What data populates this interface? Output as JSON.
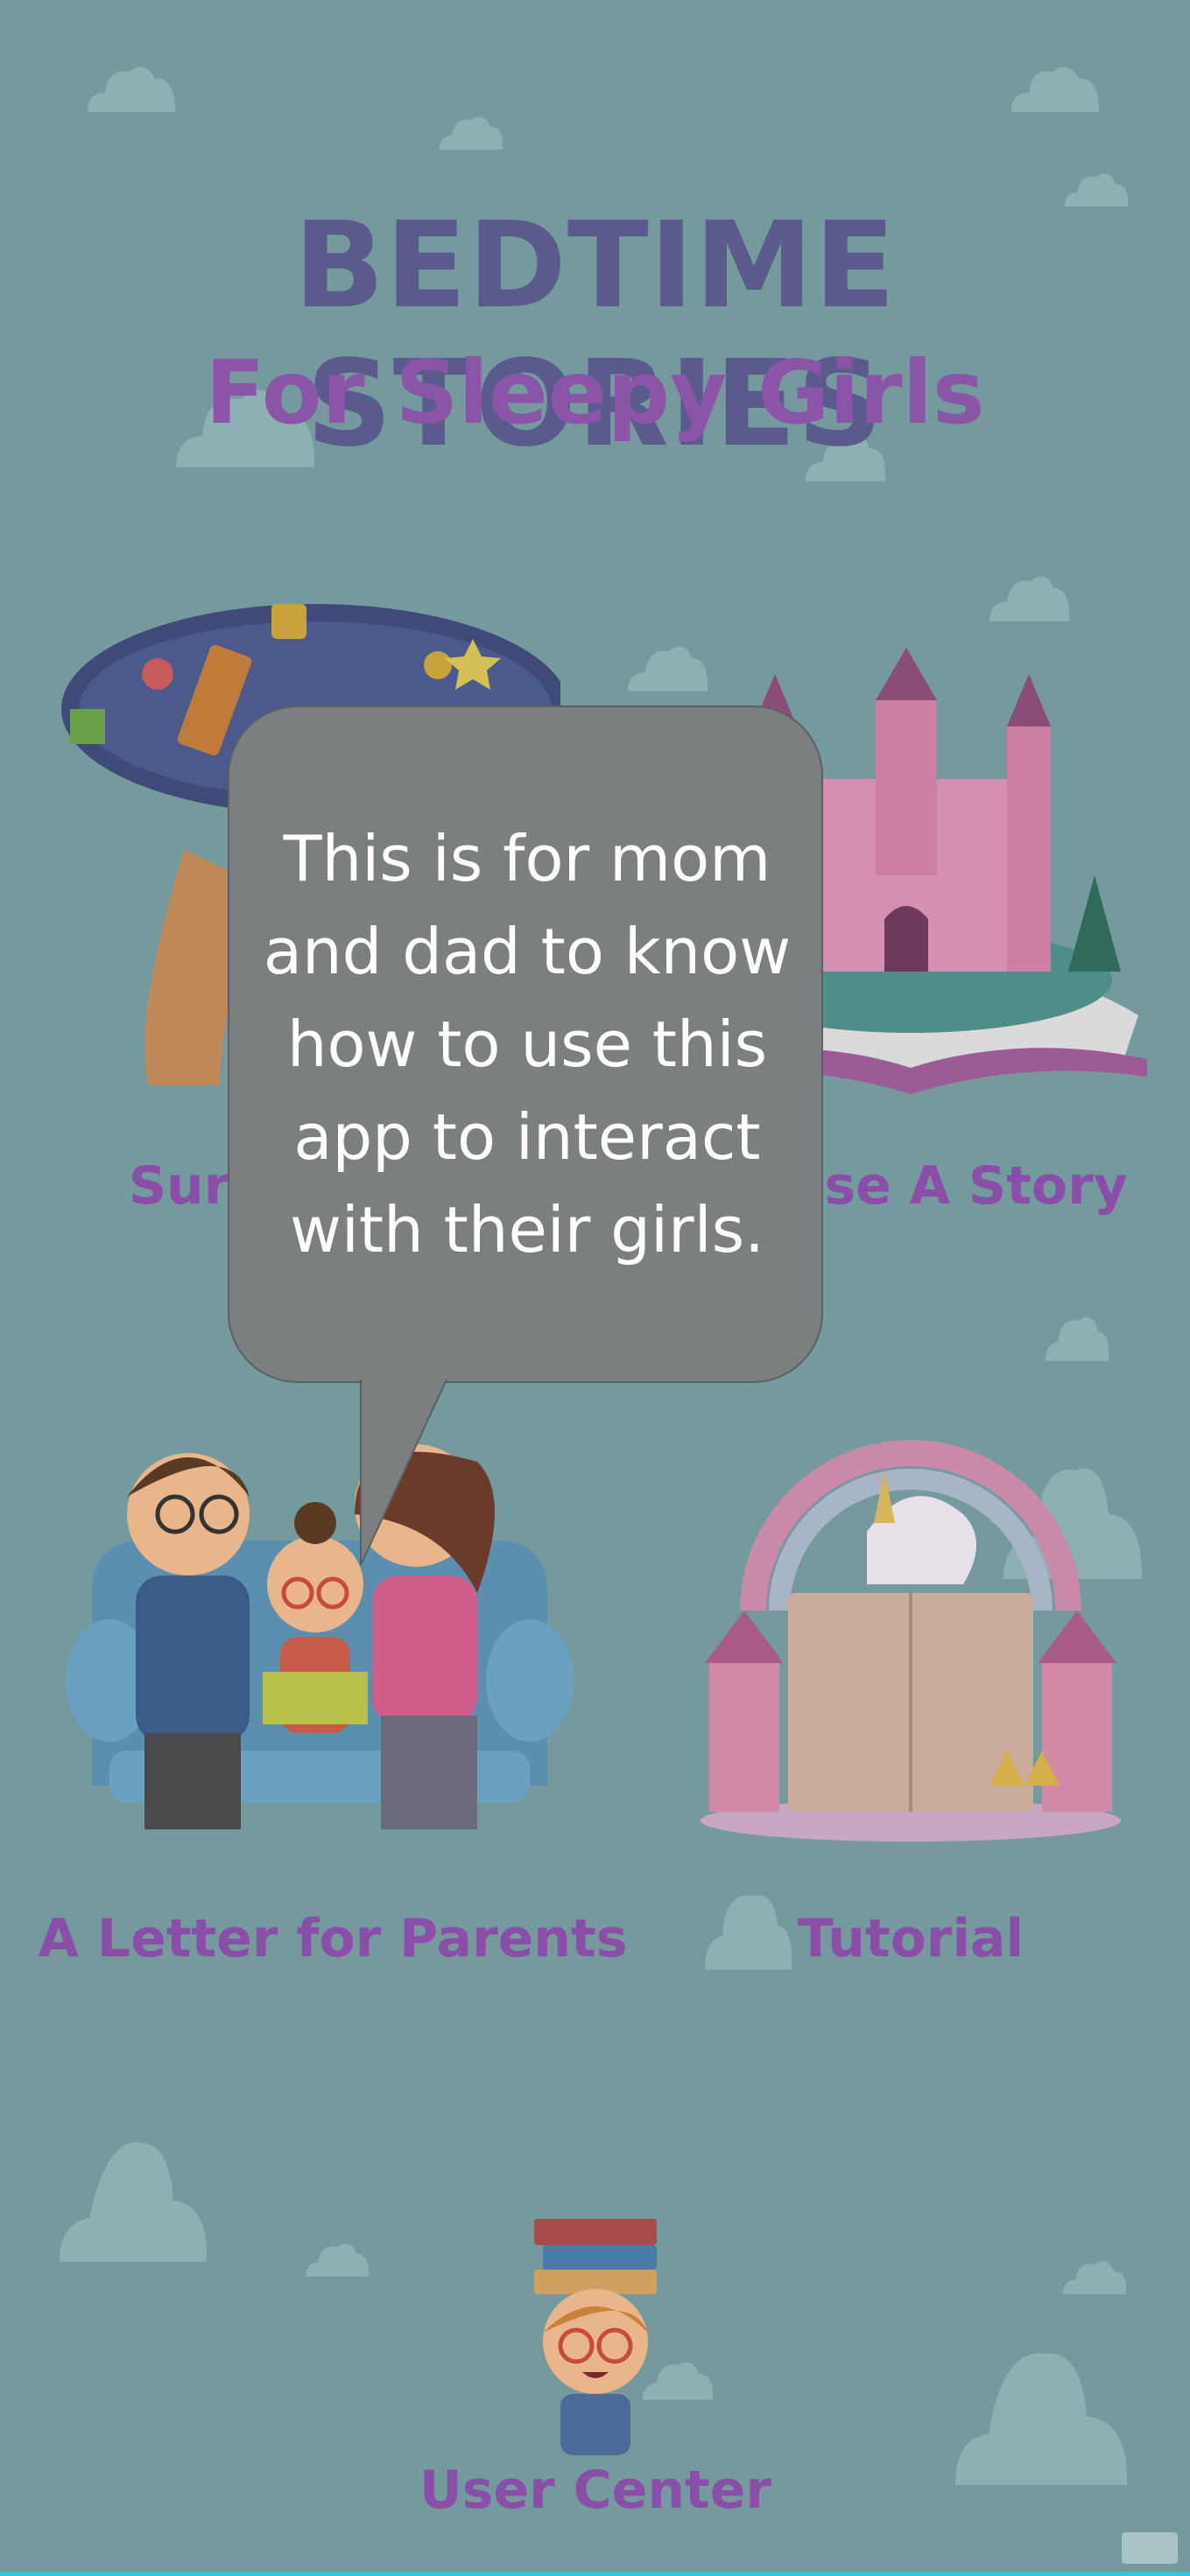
{
  "app": {
    "title": "BEDTIME STORIES",
    "subtitle": "For Sleepy Girls"
  },
  "menu": {
    "surprise_me": "Surprise Me",
    "choose_story": "Choose A Story",
    "letter_parents": "A Letter for Parents",
    "tutorial": "Tutorial",
    "user_center": "User Center"
  },
  "tooltip": {
    "text": "This is for mom and dad to know how to use this app to interact with their girls."
  },
  "colors": {
    "background": "#749a9e",
    "title": "#5b5a8c",
    "subtitle": "#8a55a6",
    "labels": "#8a4ea8",
    "bubble": "#7c7f80",
    "accent_bar": "#2ec8d8"
  }
}
